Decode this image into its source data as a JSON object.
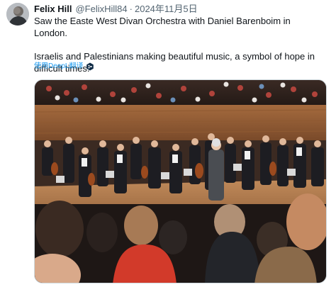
{
  "tweet": {
    "author_name": "Felix Hill",
    "author_handle": "@FelixHill84",
    "separator": "·",
    "date": "2024年11月5日",
    "text_line_1": "Saw the Easte West Divan Orchestra with Daniel Barenboim in London.",
    "text_line_2": "Israelis and Palestinians making beautiful music, a symbol of hope in difficult times.",
    "translate_label": "使用DeepL翻译"
  },
  "colors": {
    "link": "#1d9bf0",
    "secondary_text": "#536471",
    "primary_text": "#0f1419"
  },
  "icons": {
    "translate": "deepl-logo-icon"
  }
}
